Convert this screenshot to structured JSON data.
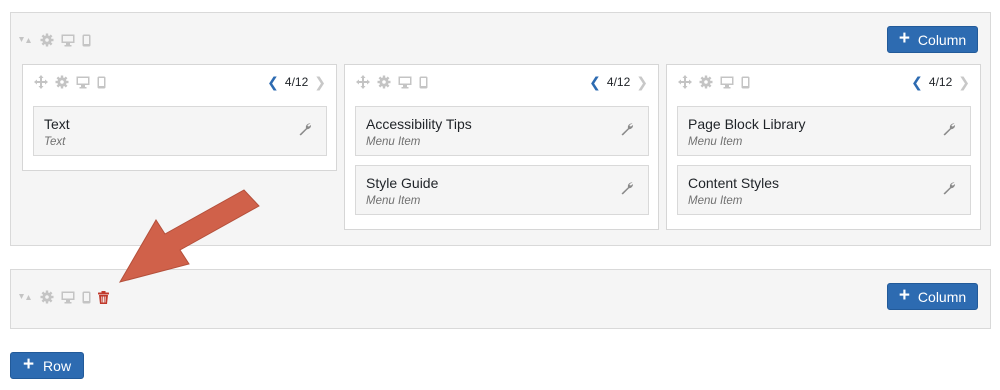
{
  "colors": {
    "accent": "#2d6bb1",
    "danger": "#c0392b",
    "arrow": "#d0614a"
  },
  "icons": [
    "collapse-icon",
    "gear-icon",
    "desktop-icon",
    "mobile-icon",
    "move-icon",
    "wrench-icon",
    "trash-icon"
  ],
  "rows": [
    {
      "add_column_label": "Column",
      "columns": [
        {
          "width": "4/12",
          "items": [
            {
              "title": "Text",
              "subtitle": "Text"
            }
          ]
        },
        {
          "width": "4/12",
          "items": [
            {
              "title": "Accessibility Tips",
              "subtitle": "Menu Item"
            },
            {
              "title": "Style Guide",
              "subtitle": "Menu Item"
            }
          ]
        },
        {
          "width": "4/12",
          "items": [
            {
              "title": "Page Block Library",
              "subtitle": "Menu Item"
            },
            {
              "title": "Content Styles",
              "subtitle": "Menu Item"
            }
          ]
        }
      ]
    },
    {
      "add_column_label": "Column",
      "columns": []
    }
  ],
  "add_row_label": "Row"
}
